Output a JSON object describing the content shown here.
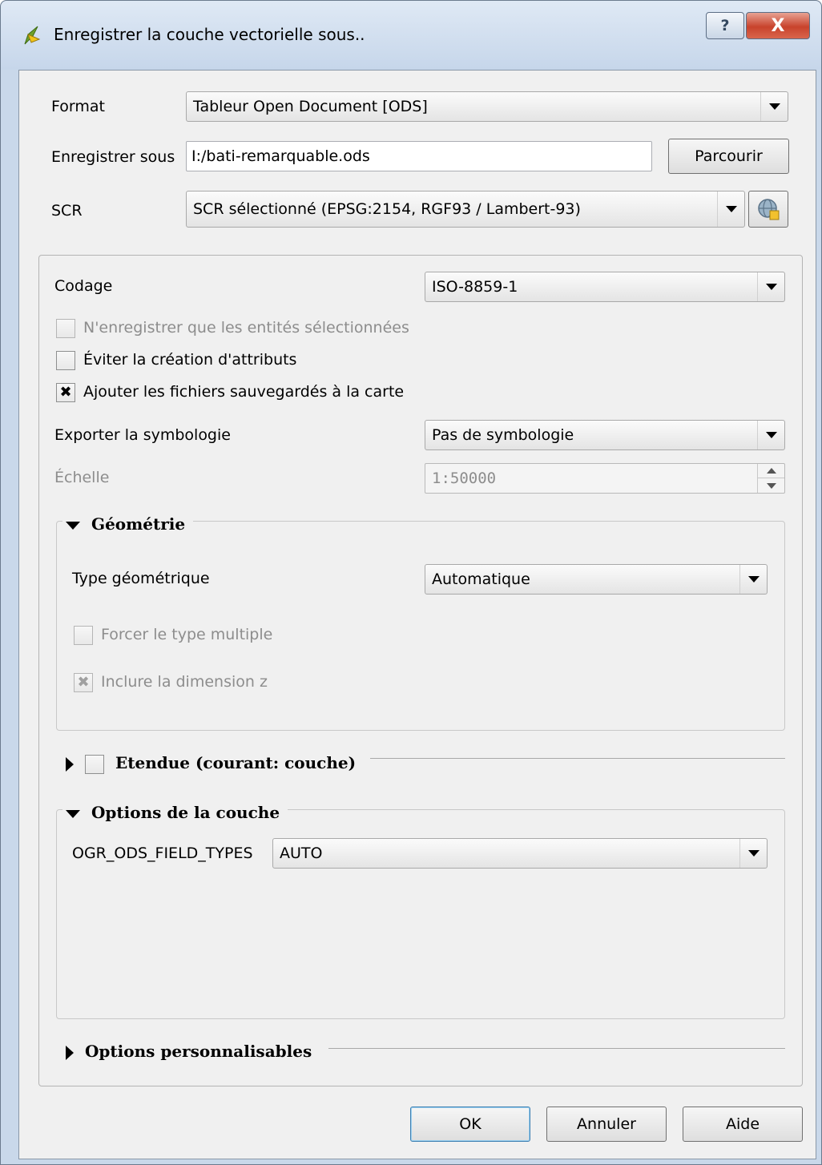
{
  "window": {
    "title": "Enregistrer la couche vectorielle sous..",
    "help_label": "?",
    "close_label": "X"
  },
  "format": {
    "label": "Format",
    "value": "Tableur Open Document  [ODS]"
  },
  "save_as": {
    "label": "Enregistrer sous",
    "value": "I:/bati-remarquable.ods",
    "browse_label": "Parcourir"
  },
  "scr": {
    "label": "SCR",
    "value": "SCR sélectionné (EPSG:2154, RGF93 / Lambert-93)"
  },
  "codage": {
    "label": "Codage",
    "value": "ISO-8859-1"
  },
  "checks": {
    "selected_only": {
      "label": "N'enregistrer que les entités sélectionnées",
      "mark": ""
    },
    "skip_attributes": {
      "label": "Éviter la création d'attributs",
      "mark": ""
    },
    "add_to_map": {
      "label": "Ajouter les fichiers sauvegardés à la carte",
      "mark": "✖"
    }
  },
  "symbology": {
    "label": "Exporter la symbologie",
    "value": "Pas de symbologie"
  },
  "scale": {
    "label": "Échelle",
    "value": "1:50000"
  },
  "geometry": {
    "title": "Géométrie",
    "type_label": "Type géométrique",
    "type_value": "Automatique",
    "force_multi_label": "Forcer le type multiple",
    "force_multi_mark": "",
    "include_z_label": "Inclure la dimension z",
    "include_z_mark": "✖"
  },
  "extent": {
    "title": "Etendue (courant: couche)"
  },
  "layer_options": {
    "title": "Options de la couche",
    "field_label": "OGR_ODS_FIELD_TYPES",
    "field_value": "AUTO"
  },
  "custom_options": {
    "title": "Options personnalisables"
  },
  "buttons": {
    "ok": "OK",
    "cancel": "Annuler",
    "help": "Aide"
  }
}
